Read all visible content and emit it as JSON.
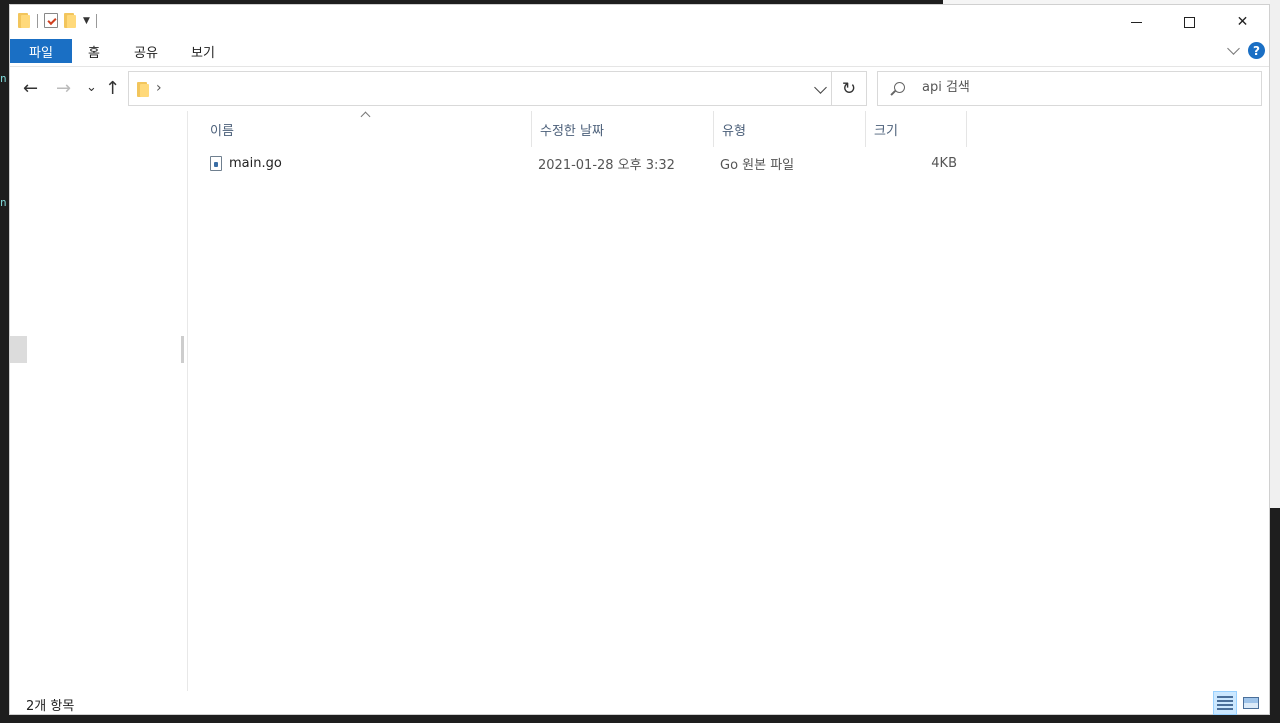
{
  "window": {
    "controls": {
      "minimize": "",
      "maximize": "",
      "close": "✕"
    }
  },
  "ribbon": {
    "tabs": [
      "파일",
      "홈",
      "공유",
      "보기"
    ],
    "help": "?"
  },
  "nav": {
    "back": "←",
    "forward": "→",
    "recent": "⌄",
    "up": "↑",
    "address_separator": "›",
    "refresh": "↻"
  },
  "search": {
    "placeholder": "api 검색"
  },
  "columns": [
    "이름",
    "수정한 날짜",
    "유형",
    "크기"
  ],
  "files": [
    {
      "name": "main.go",
      "modified": "2021-01-28 오후 3:32",
      "type": "Go 원본 파일",
      "size": "4KB"
    }
  ],
  "status": {
    "item_count": "2개 항목"
  },
  "background": {
    "side_letters": [
      "n",
      "n"
    ]
  },
  "colors": {
    "accent": "#1a6fc4",
    "header_text": "#4c607a",
    "folder": "#f2c55c"
  },
  "icons": [
    "folder-icon",
    "properties-icon",
    "new-folder-icon",
    "customize-dropdown-icon",
    "help-icon",
    "search-icon",
    "go-file-icon",
    "details-view-icon",
    "tiles-view-icon"
  ]
}
